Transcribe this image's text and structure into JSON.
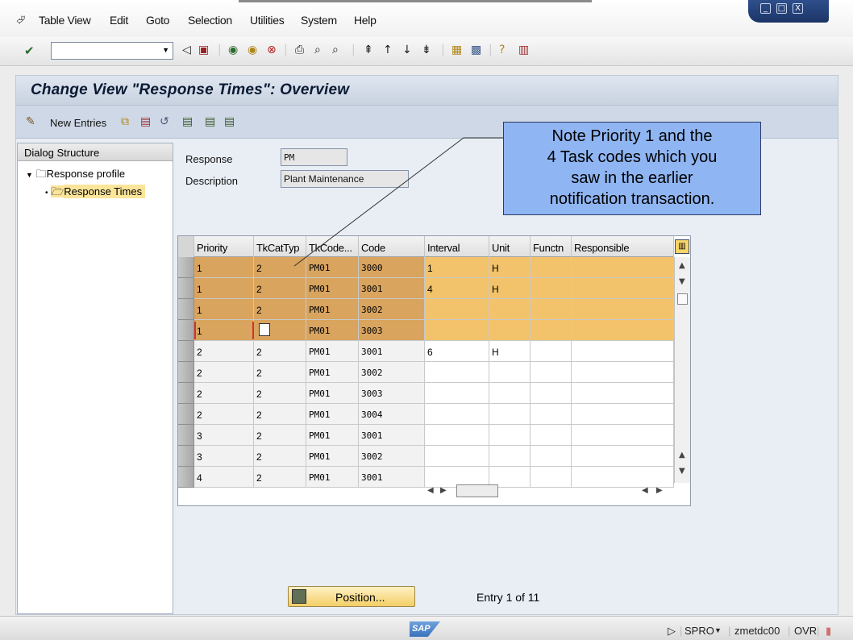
{
  "menu": [
    "Table View",
    "Edit",
    "Goto",
    "Selection",
    "Utilities",
    "System",
    "Help"
  ],
  "window_controls": [
    "_",
    "□",
    "X"
  ],
  "toolbar": {
    "command_field": ""
  },
  "page_title": "Change View \"Response Times\": Overview",
  "app_toolbar": {
    "new_entries_label": "New Entries"
  },
  "dialog_structure": {
    "header": "Dialog Structure",
    "nodes": [
      {
        "label": "Response profile"
      },
      {
        "label": "Response Times"
      }
    ]
  },
  "form": {
    "response_label": "Response",
    "response_value": "PM",
    "description_label": "Description",
    "description_value": "Plant Maintenance"
  },
  "table": {
    "columns": [
      "Priority",
      "TkCatTyp",
      "TkCode...",
      "Code",
      "Interval",
      "Unit",
      "Functn",
      "Responsible"
    ],
    "rows": [
      [
        "1",
        "2",
        "PM01",
        "3000",
        "1",
        "H",
        "",
        ""
      ],
      [
        "1",
        "2",
        "PM01",
        "3001",
        "4",
        "H",
        "",
        ""
      ],
      [
        "1",
        "2",
        "PM01",
        "3002",
        "",
        "",
        "",
        ""
      ],
      [
        "1",
        "",
        "PM01",
        "3003",
        "",
        "",
        "",
        ""
      ],
      [
        "2",
        "2",
        "PM01",
        "3001",
        "6",
        "H",
        "",
        ""
      ],
      [
        "2",
        "2",
        "PM01",
        "3002",
        "",
        "",
        "",
        ""
      ],
      [
        "2",
        "2",
        "PM01",
        "3003",
        "",
        "",
        "",
        ""
      ],
      [
        "2",
        "2",
        "PM01",
        "3004",
        "",
        "",
        "",
        ""
      ],
      [
        "3",
        "2",
        "PM01",
        "3001",
        "",
        "",
        "",
        ""
      ],
      [
        "3",
        "2",
        "PM01",
        "3002",
        "",
        "",
        "",
        ""
      ],
      [
        "4",
        "2",
        "PM01",
        "3001",
        "",
        "",
        "",
        ""
      ]
    ]
  },
  "callout": {
    "lines": [
      "Note Priority 1 and the",
      "4 Task codes which you",
      "saw in the earlier",
      "notification transaction."
    ]
  },
  "position_button": "Position...",
  "entry_info": "Entry 1 of 11",
  "status": {
    "transaction": "SPRO",
    "server": "zmetdc00",
    "mode": "OVR"
  },
  "brand": "SAP",
  "colors": {
    "highlight_row": "#f2c36b",
    "highlight_key": "#d9a45e",
    "callout": "#8fb5f2",
    "title_bar": "#c8d2e0"
  }
}
